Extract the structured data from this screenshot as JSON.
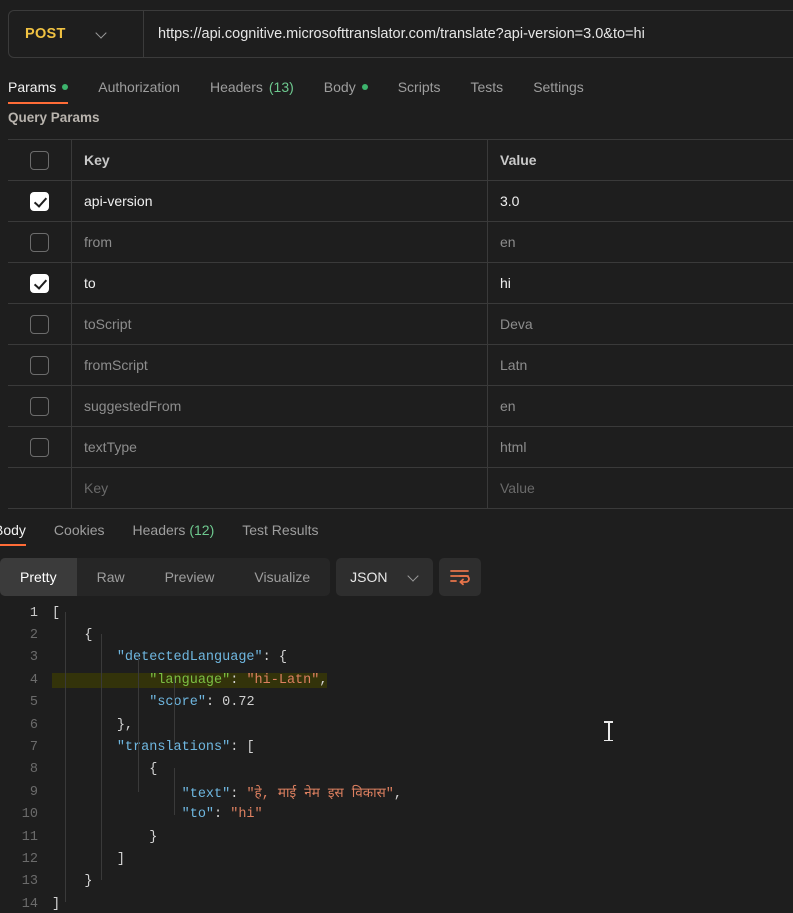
{
  "request": {
    "method": "POST",
    "url": "https://api.cognitive.microsofttranslator.com/translate?api-version=3.0&to=hi",
    "tabs": [
      {
        "label": "Params",
        "badge_dot": true,
        "active": true
      },
      {
        "label": "Authorization",
        "active": false
      },
      {
        "label": "Headers",
        "count": "(13)",
        "active": false
      },
      {
        "label": "Body",
        "badge_dot": true,
        "active": false
      },
      {
        "label": "Scripts",
        "active": false
      },
      {
        "label": "Tests",
        "active": false
      },
      {
        "label": "Settings",
        "active": false
      }
    ],
    "query_params_heading": "Query Params",
    "table": {
      "headers": {
        "key": "Key",
        "value": "Value"
      },
      "rows": [
        {
          "checked": true,
          "key": "api-version",
          "value": "3.0"
        },
        {
          "checked": false,
          "key": "from",
          "value": "en"
        },
        {
          "checked": true,
          "key": "to",
          "value": "hi"
        },
        {
          "checked": false,
          "key": "toScript",
          "value": "Deva"
        },
        {
          "checked": false,
          "key": "fromScript",
          "value": "Latn"
        },
        {
          "checked": false,
          "key": "suggestedFrom",
          "value": "en"
        },
        {
          "checked": false,
          "key": "textType",
          "value": "html"
        }
      ],
      "placeholder_row": {
        "key": "Key",
        "value": "Value"
      }
    }
  },
  "response": {
    "tabs": [
      {
        "label": "Body",
        "active": true
      },
      {
        "label": "Cookies",
        "active": false
      },
      {
        "label": "Headers",
        "count": "(12)",
        "active": false
      },
      {
        "label": "Test Results",
        "active": false
      }
    ],
    "view_modes": [
      {
        "label": "Pretty",
        "active": true
      },
      {
        "label": "Raw",
        "active": false
      },
      {
        "label": "Preview",
        "active": false
      },
      {
        "label": "Visualize",
        "active": false
      }
    ],
    "format": "JSON",
    "wrap_icon": "wrap-lines-icon",
    "body_lines": [
      {
        "n": "1",
        "indent": 0,
        "tokens": [
          {
            "t": "[",
            "c": "p"
          }
        ]
      },
      {
        "n": "2",
        "indent": 1,
        "tokens": [
          {
            "t": "{",
            "c": "p"
          }
        ]
      },
      {
        "n": "3",
        "indent": 2,
        "tokens": [
          {
            "t": "\"detectedLanguage\"",
            "c": "k"
          },
          {
            "t": ": ",
            "c": "p"
          },
          {
            "t": "{",
            "c": "p"
          }
        ]
      },
      {
        "n": "4",
        "indent": 3,
        "highlight": true,
        "tokens": [
          {
            "t": "\"language\"",
            "c": "k"
          },
          {
            "t": ": ",
            "c": "p"
          },
          {
            "t": "\"hi-Latn\"",
            "c": "s"
          },
          {
            "t": ",",
            "c": "p"
          }
        ]
      },
      {
        "n": "5",
        "indent": 3,
        "tokens": [
          {
            "t": "\"score\"",
            "c": "k"
          },
          {
            "t": ": ",
            "c": "p"
          },
          {
            "t": "0.72",
            "c": "n"
          }
        ]
      },
      {
        "n": "6",
        "indent": 2,
        "tokens": [
          {
            "t": "},",
            "c": "p"
          }
        ]
      },
      {
        "n": "7",
        "indent": 2,
        "tokens": [
          {
            "t": "\"translations\"",
            "c": "k"
          },
          {
            "t": ": ",
            "c": "p"
          },
          {
            "t": "[",
            "c": "p"
          }
        ]
      },
      {
        "n": "8",
        "indent": 3,
        "tokens": [
          {
            "t": "{",
            "c": "p"
          }
        ]
      },
      {
        "n": "9",
        "indent": 4,
        "tokens": [
          {
            "t": "\"text\"",
            "c": "k"
          },
          {
            "t": ": ",
            "c": "p"
          },
          {
            "t": "\"हे, माई नेम इस विकास\"",
            "c": "s"
          },
          {
            "t": ",",
            "c": "p"
          }
        ]
      },
      {
        "n": "10",
        "indent": 4,
        "tokens": [
          {
            "t": "\"to\"",
            "c": "k"
          },
          {
            "t": ": ",
            "c": "p"
          },
          {
            "t": "\"hi\"",
            "c": "s"
          }
        ]
      },
      {
        "n": "11",
        "indent": 3,
        "tokens": [
          {
            "t": "}",
            "c": "p"
          }
        ]
      },
      {
        "n": "12",
        "indent": 2,
        "tokens": [
          {
            "t": "]",
            "c": "p"
          }
        ]
      },
      {
        "n": "13",
        "indent": 1,
        "tokens": [
          {
            "t": "}",
            "c": "p"
          }
        ]
      },
      {
        "n": "14",
        "indent": 0,
        "tokens": [
          {
            "t": "]",
            "c": "p"
          }
        ]
      }
    ]
  },
  "colors": {
    "accent": "#ff6c37",
    "method": "#f0c242",
    "badge_green": "#3db46d",
    "count_green": "#6ec98f",
    "background": "#1e1e1e"
  }
}
